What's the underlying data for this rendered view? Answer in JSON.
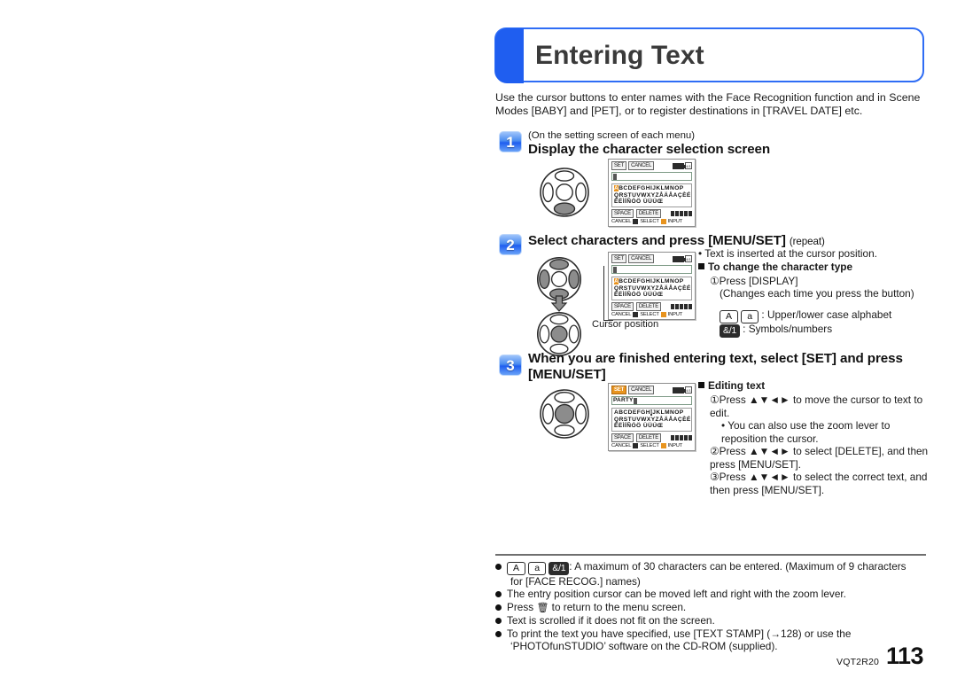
{
  "header": {
    "title": "Entering Text",
    "accent_color": "#1f5ef0"
  },
  "intro": "Use the cursor buttons to enter names with the Face Recognition function and in Scene Modes [BABY] and [PET], or to register destinations in [TRAVEL DATE] etc.",
  "steps": [
    {
      "number": "1",
      "note": "(On the setting screen of each menu)",
      "heading": "Display the character selection screen"
    },
    {
      "number": "2",
      "heading": "Select characters and press [MENU/SET]",
      "heading_suffix": "(repeat)",
      "caption": "Cursor position",
      "right": {
        "bullet": "• Text is inserted at the cursor position.",
        "sub_heading": "To change the character type",
        "line1": "①Press [DISPLAY]",
        "line2": "(Changes each time you press the button)",
        "keycap_a_upper": "A",
        "keycap_a_lower": "a",
        "keycap_symbols": "&/1",
        "legend_alpha": ": Upper/lower case alphabet",
        "legend_symbols": ": Symbols/numbers"
      }
    },
    {
      "number": "3",
      "heading": "When you are finished entering text, select [SET] and press [MENU/SET]",
      "right": {
        "sub_heading": "Editing text",
        "line1": "①Press ▲▼◄► to move the cursor to text to edit.",
        "line1b": "• You can also use the zoom lever to reposition the cursor.",
        "line2": "②Press ▲▼◄► to select [DELETE], and then press [MENU/SET].",
        "line3": "③Press ▲▼◄► to select the correct text, and then press [MENU/SET]."
      }
    }
  ],
  "lcd": {
    "btn_set": "SET",
    "btn_cancel": "CANCEL",
    "row_a": "ABCDEFGHIJKLMNOP",
    "row_b": "QRSTUVWXYZÅÄÅAÇÈÉ",
    "row_c": "ÊËÌÍÑÓÖ  ÙÜÚŒ",
    "btn_space": "SPACE",
    "btn_delete": "DELETE",
    "foot_cancel": "CANCEL",
    "foot_select": "SELECT",
    "foot_input": "INPUT",
    "typed_text": "PARTY",
    "batt_label": "4/1"
  },
  "notes": [
    {
      "keycaps": [
        "A",
        "a",
        "&/1"
      ],
      "text": ": A maximum of 30 characters can be entered. (Maximum of 9 characters",
      "text2": "for [FACE RECOG.] names)"
    },
    {
      "text": "The entry position cursor can be moved left and right with the zoom lever."
    },
    {
      "text_pre": "Press ",
      "icon": "trash-icon",
      "text_post": " to return to the menu screen."
    },
    {
      "text": "Text is scrolled if it does not fit on the screen."
    },
    {
      "text": "To print the text you have specified, use [TEXT STAMP] (→128) or use the",
      "text2": "‘PHOTOfunSTUDIO’ software on the CD-ROM (supplied)."
    }
  ],
  "footer": {
    "code": "VQT2R20",
    "page": "113"
  }
}
